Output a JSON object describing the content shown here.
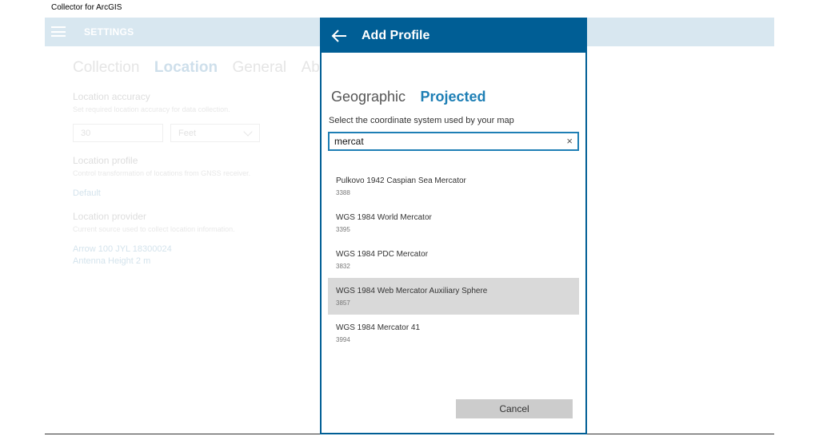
{
  "window": {
    "title": "Collector for ArcGIS"
  },
  "header": {
    "title": "SETTINGS"
  },
  "settings_tabs": [
    {
      "label": "Collection",
      "active": false
    },
    {
      "label": "Location",
      "active": true
    },
    {
      "label": "General",
      "active": false
    },
    {
      "label": "About",
      "active": false
    }
  ],
  "location": {
    "accuracy_label": "Location accuracy",
    "accuracy_desc": "Set required location accuracy for data collection.",
    "accuracy_value": "30",
    "accuracy_unit": "Feet",
    "profile_label": "Location profile",
    "profile_desc": "Control transformation of locations from GNSS receiver.",
    "profile_value": "Default",
    "provider_label": "Location provider",
    "provider_desc": "Current source used to collect location information.",
    "provider_line1": "Arrow 100 JYL 18300024",
    "provider_line2": "Antenna Height 2 m"
  },
  "dialog": {
    "title": "Add Profile",
    "tabs": [
      {
        "label": "Geographic",
        "active": false
      },
      {
        "label": "Projected",
        "active": true
      }
    ],
    "instruction": "Select the coordinate system used by your map",
    "search_value": "mercat",
    "clear_icon": "×",
    "results": [
      {
        "name": "Pulkovo 1942 Caspian Sea Mercator",
        "code": "3388",
        "selected": false
      },
      {
        "name": "WGS 1984 World Mercator",
        "code": "3395",
        "selected": false
      },
      {
        "name": "WGS 1984 PDC Mercator",
        "code": "3832",
        "selected": false
      },
      {
        "name": "WGS 1984 Web Mercator Auxiliary Sphere",
        "code": "3857",
        "selected": true
      },
      {
        "name": "WGS 1984 Mercator 41",
        "code": "3994",
        "selected": false
      }
    ],
    "cancel_label": "Cancel"
  },
  "colors": {
    "header_bg": "#a9c9dd",
    "dialog_accent": "#005e95",
    "active_tab": "#1e7fb5",
    "selected_row": "#d9d9d9"
  }
}
